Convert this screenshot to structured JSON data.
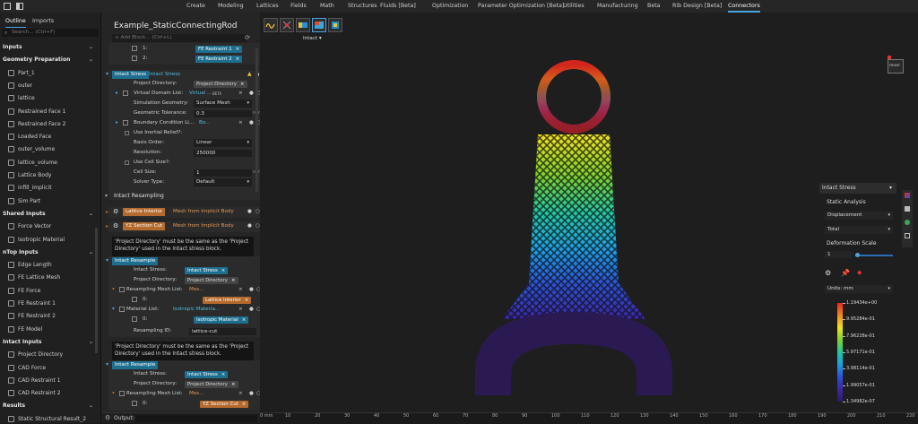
{
  "menu": {
    "items": [
      "Create",
      "Modeling",
      "Lattices",
      "Fields",
      "Math",
      "Structures",
      "Fluids [Beta]",
      "Optimization",
      "Parameter Optimization [Beta]",
      "Utilities",
      "Manufacturing",
      "Beta",
      "Rib Design [Beta]",
      "Connectors"
    ],
    "active_index": 13
  },
  "left": {
    "tabs": [
      "Outline",
      "Imports"
    ],
    "search_placeholder": "Search... (Ctrl+F)",
    "rows": [
      {
        "type": "head",
        "label": "Inputs"
      },
      {
        "type": "head",
        "label": "Geometry Preparation"
      },
      {
        "type": "item",
        "label": "Part_1",
        "icon": "cube-icon"
      },
      {
        "type": "item",
        "label": "outer",
        "icon": "body-icon"
      },
      {
        "type": "item",
        "label": "lattice",
        "icon": "body-icon"
      },
      {
        "type": "item",
        "label": "Restrained Face 1",
        "icon": "face-icon"
      },
      {
        "type": "item",
        "label": "Restrained Face 2",
        "icon": "face-icon"
      },
      {
        "type": "item",
        "label": "Loaded Face",
        "icon": "face-icon"
      },
      {
        "type": "item",
        "label": "outer_volume",
        "icon": "body-icon"
      },
      {
        "type": "item",
        "label": "lattice_volume",
        "icon": "body-icon"
      },
      {
        "type": "item",
        "label": "Lattice Body",
        "icon": "body-icon"
      },
      {
        "type": "item",
        "label": "infill_implicit",
        "icon": "body-icon"
      },
      {
        "type": "item",
        "label": "Sim Part",
        "icon": "body-icon"
      },
      {
        "type": "head",
        "label": "Shared Inputs"
      },
      {
        "type": "item",
        "label": "Force Vector",
        "icon": "vector-icon"
      },
      {
        "type": "item",
        "label": "Isotropic Material",
        "icon": "material-icon"
      },
      {
        "type": "head",
        "label": "nTop Inputs"
      },
      {
        "type": "item",
        "label": "Edge Length",
        "icon": "number-icon"
      },
      {
        "type": "item",
        "label": "FE Lattice Mesh",
        "icon": "mesh-icon"
      },
      {
        "type": "item",
        "label": "FE Force",
        "icon": "force-icon"
      },
      {
        "type": "item",
        "label": "FE Restraint 1",
        "icon": "restraint-icon"
      },
      {
        "type": "item",
        "label": "FE Restraint 2",
        "icon": "restraint-icon"
      },
      {
        "type": "item",
        "label": "FE Model",
        "icon": "model-icon"
      },
      {
        "type": "head",
        "label": "Intact Inputs"
      },
      {
        "type": "item",
        "label": "Project Directory",
        "icon": "folder-icon"
      },
      {
        "type": "item",
        "label": "CAD Force",
        "icon": "force-icon"
      },
      {
        "type": "item",
        "label": "CAD Restraint 1",
        "icon": "restraint-icon"
      },
      {
        "type": "item",
        "label": "CAD Restraint 2",
        "icon": "restraint-icon"
      },
      {
        "type": "head",
        "label": "Results"
      },
      {
        "type": "item",
        "label": "Static Structural Result_2",
        "icon": "result-icon"
      }
    ]
  },
  "middle": {
    "title": "Example_StaticConnectingRod",
    "add_block_placeholder": "+ Add Block... (Ctrl+L)",
    "top_list": [
      {
        "index": "1:",
        "chip": "FE Restraint 1"
      },
      {
        "index": "2:",
        "chip": "FE Restraint 2"
      }
    ],
    "intact_stress": {
      "block_type": "Intact Stress",
      "name": "Intact Stress",
      "rows": {
        "project_directory": {
          "label": "Project Directory:",
          "chip": "Project Directory"
        },
        "virtual_domain": {
          "label": "Virtual Domain List:",
          "chip": "Virtual ...",
          "badge": "BETA"
        },
        "simulation_geometry": {
          "label": "Simulation Geometry:",
          "value": "Surface Mesh"
        },
        "geometric_tolerance": {
          "label": "Geometric Tolerance:",
          "value": "0.3",
          "unit": "mm"
        },
        "boundary_condition": {
          "label": "Boundary Condition Li...",
          "chip": "Bo..."
        },
        "inertial_relief": {
          "label": "Use Inertial Relief?:"
        },
        "basis_order": {
          "label": "Basis Order:",
          "value": "Linear"
        },
        "resolution": {
          "label": "Resolution:",
          "value": "250000"
        },
        "use_cell_size": {
          "label": "Use Cell Size?:"
        },
        "cell_size": {
          "label": "Cell Size:",
          "value": "1",
          "unit": "mm"
        },
        "solver_type": {
          "label": "Solver Type:",
          "value": "Default"
        }
      }
    },
    "section_title": "Intact Resampling",
    "lattice_interior": {
      "name": "Lattice Interior",
      "type": "Mesh from Implicit Body"
    },
    "yz_section": {
      "name": "YZ Section Cut",
      "type": "Mesh from Implicit Body"
    },
    "note": "'Project Directory' must be the same as the 'Project Directory' used in the Intact stress block.",
    "resample1": {
      "block_type": "Intact Resample",
      "intact_stress": {
        "label": "Intact Stress:",
        "chip": "Intact Stress"
      },
      "project_directory": {
        "label": "Project Directory:",
        "chip": "Project Directory"
      },
      "resampling_mesh": {
        "label": "Resampling Mesh List:",
        "chip": "Mes..."
      },
      "item0": {
        "label": "0:",
        "chip": "Lattice Interior"
      },
      "material_list": {
        "label": "Material List:",
        "chip": "Isotropic Materia..."
      },
      "material0": {
        "label": "0:",
        "chip": "Isotropic Material"
      },
      "resampling_id": {
        "label": "Resampling ID:",
        "value": "lattice-cut"
      }
    },
    "resample2": {
      "block_type": "Intact Resample",
      "intact_stress": {
        "label": "Intact Stress:",
        "chip": "Intact Stress"
      },
      "project_directory": {
        "label": "Project Directory:",
        "chip": "Project Directory"
      },
      "resampling_mesh": {
        "label": "Resampling Mesh List:",
        "chip": "Mes..."
      },
      "item0": {
        "label": "0:",
        "chip": "YZ Section Cut"
      }
    },
    "output_label": "Output:"
  },
  "viewport": {
    "mode_label": "Intact",
    "cube_label": "FRONT",
    "ruler_unit": "0 mm",
    "ruler_ticks": [
      "10",
      "20",
      "30",
      "40",
      "50",
      "60",
      "70",
      "80",
      "90",
      "100",
      "110",
      "120",
      "130",
      "140",
      "150",
      "160",
      "170",
      "180",
      "190",
      "200",
      "210",
      "220"
    ]
  },
  "props": {
    "title": "Intact Stress",
    "analysis_label": "Static Analysis",
    "field": "Displacement",
    "component": "Total",
    "scale_label": "Deformation Scale",
    "scale_value": "1",
    "scale_fraction": 0.05,
    "units": "Units: mm",
    "legend": [
      "1.19434e+00",
      "9.95284e-01",
      "7.96228e-01",
      "5.97171e-01",
      "3.98114e-01",
      "1.99057e-01",
      "1.34982e-07"
    ]
  },
  "colors": {
    "accent": "#4aa3df",
    "teal_chip": "#1e6f8f",
    "orange_chip": "#b56a2d"
  }
}
